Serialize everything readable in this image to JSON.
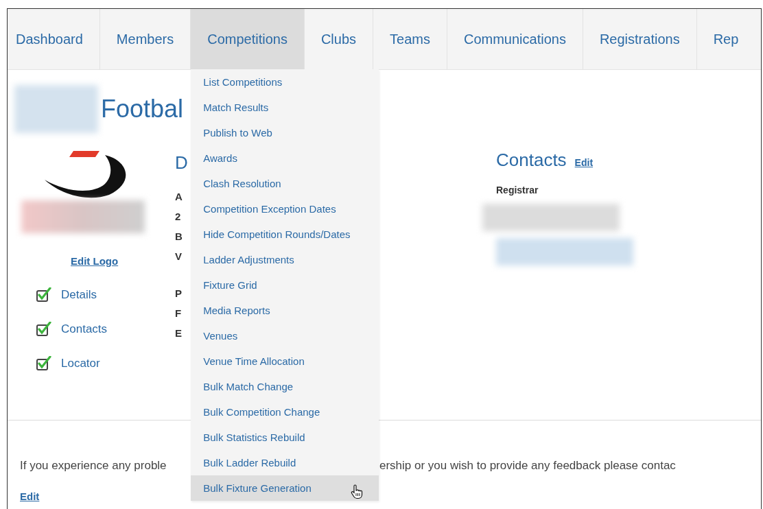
{
  "nav": {
    "tabs": [
      {
        "label": "Dashboard",
        "selected": false
      },
      {
        "label": "Members",
        "selected": false
      },
      {
        "label": "Competitions",
        "selected": true
      },
      {
        "label": "Clubs",
        "selected": false
      },
      {
        "label": "Teams",
        "selected": false
      },
      {
        "label": "Communications",
        "selected": false
      },
      {
        "label": "Registrations",
        "selected": false
      },
      {
        "label": "Rep",
        "selected": false
      }
    ]
  },
  "dropdown": {
    "items": [
      {
        "label": "List Competitions",
        "hovered": false
      },
      {
        "label": "Match Results",
        "hovered": false
      },
      {
        "label": "Publish to Web",
        "hovered": false
      },
      {
        "label": "Awards",
        "hovered": false
      },
      {
        "label": "Clash Resolution",
        "hovered": false
      },
      {
        "label": "Competition Exception Dates",
        "hovered": false
      },
      {
        "label": "Hide Competition Rounds/Dates",
        "hovered": false
      },
      {
        "label": "Ladder Adjustments",
        "hovered": false
      },
      {
        "label": "Fixture Grid",
        "hovered": false
      },
      {
        "label": "Media Reports",
        "hovered": false
      },
      {
        "label": "Venues",
        "hovered": false
      },
      {
        "label": "Venue Time Allocation",
        "hovered": false
      },
      {
        "label": "Bulk Match Change",
        "hovered": false
      },
      {
        "label": "Bulk Competition Change",
        "hovered": false
      },
      {
        "label": "Bulk Statistics Rebuild",
        "hovered": false
      },
      {
        "label": "Bulk Ladder Rebuild",
        "hovered": false
      },
      {
        "label": "Bulk Fixture Generation",
        "hovered": true
      }
    ]
  },
  "profile": {
    "title": "Footbal",
    "edit_logo": "Edit Logo",
    "checklist": [
      {
        "label": "Details",
        "checked": true
      },
      {
        "label": "Contacts",
        "checked": true
      },
      {
        "label": "Locator",
        "checked": true
      }
    ]
  },
  "details": {
    "heading": "D",
    "labels": [
      "A",
      "2",
      "B",
      "V",
      "P",
      "F",
      "E"
    ]
  },
  "contacts": {
    "heading": "Contacts",
    "edit": "Edit",
    "role": "Registrar"
  },
  "footer": {
    "text_start": "If you experience any proble",
    "text_end": "ership or you wish to provide any feedback please contac",
    "edit": "Edit"
  }
}
